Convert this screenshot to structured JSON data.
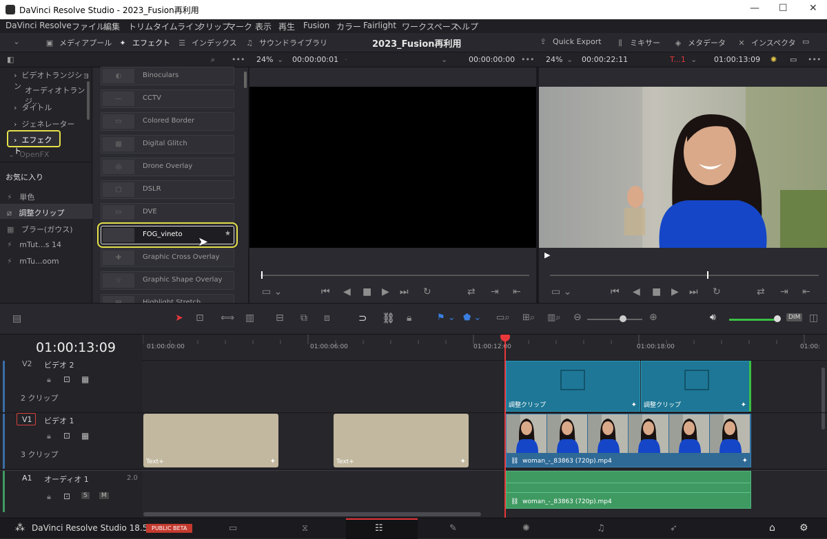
{
  "window": {
    "title": "DaVinci Resolve Studio - 2023_Fusion再利用",
    "min": "—",
    "max": "☐",
    "close": "✕"
  },
  "menu": [
    "DaVinci Resolve",
    "ファイル",
    "編集",
    "トリム",
    "タイムライン",
    "クリップ",
    "マーク",
    "表示",
    "再生",
    "Fusion",
    "カラー",
    "Fairlight",
    "ワークスペース",
    "ヘルプ"
  ],
  "toolbar": {
    "media_pool": "メディアプール",
    "effects": "エフェクト",
    "index": "インデックス",
    "sound_library": "サウンドライブラリ",
    "project_title": "2023_Fusion再利用",
    "quick_export": "Quick Export",
    "mixer": "ミキサー",
    "metadata": "メタデータ",
    "inspector": "インスペクタ"
  },
  "source_viewer": {
    "zoom": "24%",
    "timecode_left": "00:00:00:01",
    "timecode_right": "00:00:00:00",
    "dot": "·"
  },
  "timeline_viewer": {
    "zoom": "24%",
    "timecode_left": "00:00:22:11",
    "track_label": "T...1",
    "timecode_right": "01:00:13:09"
  },
  "tree": {
    "items": [
      "ビデオトランジション",
      "オーディオトランジ...",
      "タイトル",
      "ジェネレーター",
      "エフェクト",
      "OpenFX"
    ],
    "favorites_header": "お気に入り",
    "favorites": [
      "単色",
      "調整クリップ",
      "ブラー(ガウス)",
      "mTut...s 14",
      "mTu...oom"
    ]
  },
  "effects_list": [
    "Binoculars",
    "CCTV",
    "Colored Border",
    "Digital Glitch",
    "Drone Overlay",
    "DSLR",
    "DVE",
    "FOG_vineto",
    "Graphic Cross Overlay",
    "Graphic Shape Overlay",
    "Highlight Stretch"
  ],
  "timeline": {
    "current_timecode": "01:00:13:09",
    "ruler_marks": [
      "01:00:00:00",
      "01:00:06:00",
      "01:00:12:00",
      "01:00:18:00",
      "01:00:"
    ],
    "tracks": [
      {
        "id": "V2",
        "name": "ビデオ 2",
        "count": "2 クリップ"
      },
      {
        "id": "V1",
        "name": "ビデオ 1",
        "count": "3 クリップ"
      },
      {
        "id": "A1",
        "name": "オーディオ 1",
        "count": "",
        "level": "2.0",
        "s": "S",
        "m": "M"
      }
    ],
    "adj_clip_label": "調整クリップ",
    "text_clip_label": "Text+",
    "video_clip_label": "woman_-_83863 (720p).mp4",
    "audio_clip_label": "woman_-_83863 (720p).mp4",
    "dim": "DIM"
  },
  "bottom": {
    "app": "DaVinci Resolve Studio 18.5",
    "badge": "PUBLIC BETA"
  },
  "colors": {
    "accent_yellow": "#e6e14a",
    "playhead": "#e8383c",
    "adj_clip": "#1e7796",
    "audio_clip": "#3f9a62",
    "text_clip": "#c2b89f",
    "video_clip_bar": "#2f6a96"
  }
}
